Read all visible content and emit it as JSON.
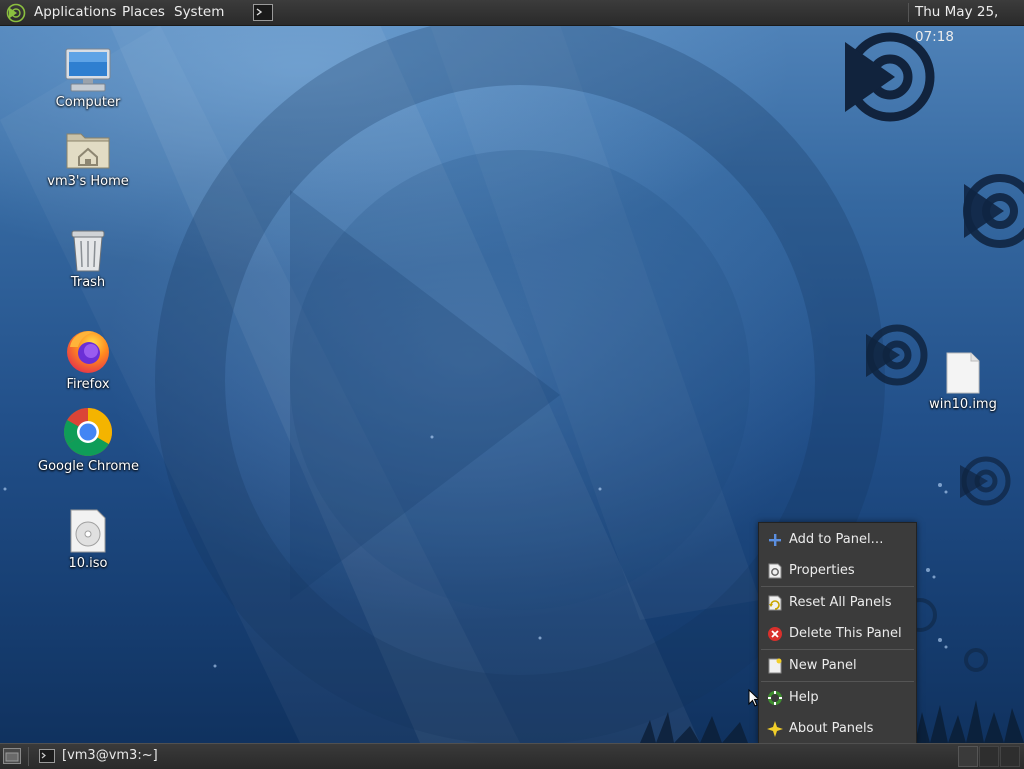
{
  "top_panel": {
    "menus": [
      "Applications",
      "Places",
      "System"
    ],
    "clock": "Thu May 25, 07:18"
  },
  "desktop": {
    "icons": [
      {
        "label": "Computer",
        "icon": "computer-icon"
      },
      {
        "label": "vm3's Home",
        "icon": "home-folder-icon"
      },
      {
        "label": "Trash",
        "icon": "trash-icon"
      },
      {
        "label": "Firefox",
        "icon": "firefox-icon"
      },
      {
        "label": "Google Chrome",
        "icon": "chrome-icon"
      },
      {
        "label": "10.iso",
        "icon": "disc-image-icon"
      },
      {
        "label": "win10.img",
        "icon": "file-icon"
      }
    ]
  },
  "context_menu": {
    "items": [
      {
        "label": "Add to Panel…",
        "icon": "plus-icon"
      },
      {
        "label": "Properties",
        "icon": "properties-icon"
      },
      {
        "label": "Reset All Panels",
        "icon": "reset-icon"
      },
      {
        "label": "Delete This Panel",
        "icon": "delete-icon"
      },
      {
        "label": "New Panel",
        "icon": "new-panel-icon"
      },
      {
        "label": "Help",
        "icon": "help-icon"
      },
      {
        "label": "About Panels",
        "icon": "about-icon"
      }
    ]
  },
  "bottom_panel": {
    "task": "[vm3@vm3:~]"
  },
  "colors": {
    "panel_bg": "#2f2f2f",
    "menu_bg": "#3b3b3b",
    "accent_green": "#8bbf3f",
    "wallpaper_blue": "#22508a"
  }
}
